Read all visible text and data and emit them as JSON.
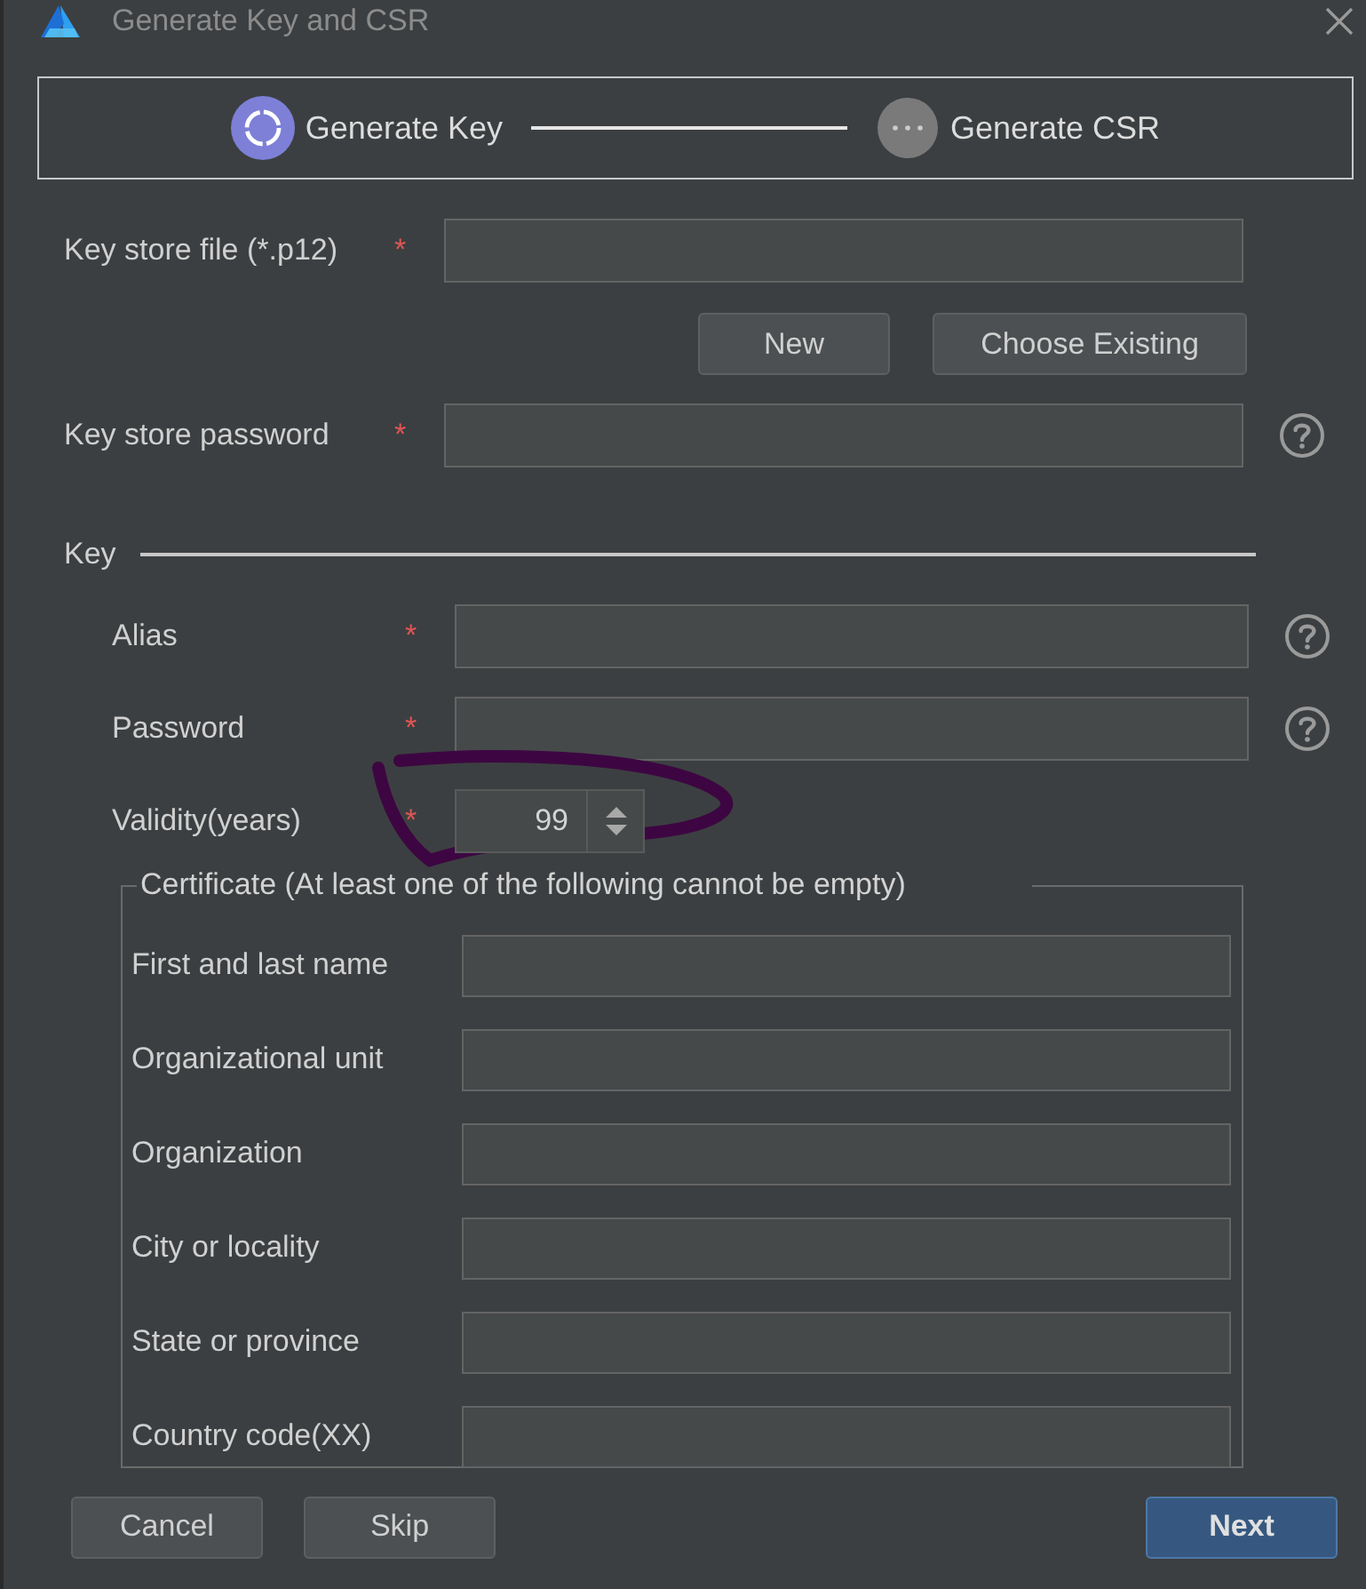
{
  "window": {
    "title": "Generate Key and CSR"
  },
  "steps": [
    {
      "label": "Generate Key",
      "selected": true
    },
    {
      "label": "Generate CSR",
      "selected": false
    }
  ],
  "store_rows": [
    {
      "kind": "field",
      "label": "Key store file (*.p12)",
      "required_mark": "*",
      "help": false
    },
    {
      "kind": "buttons",
      "buttons": [
        "New",
        "Choose Existing"
      ]
    },
    {
      "kind": "field",
      "label": "Key store password",
      "required_mark": "*",
      "help": true
    }
  ],
  "key_section": {
    "title": "Key",
    "rows": [
      {
        "kind": "field",
        "label": "Alias",
        "required_mark": "*",
        "help": true
      },
      {
        "kind": "field",
        "label": "Password",
        "required_mark": "*",
        "help": true
      },
      {
        "kind": "spinner",
        "label": "Validity(years)",
        "value": "99",
        "required_mark": "*",
        "help": false
      }
    ]
  },
  "certificate": {
    "legend": "Certificate (At least one of the following cannot be empty)",
    "fields": [
      "First and last name",
      "Organizational unit",
      "Organization",
      "City or locality",
      "State or province",
      "Country code(XX)"
    ]
  },
  "footer": {
    "buttons": [
      {
        "label": "Cancel",
        "primary": false
      },
      {
        "label": "Skip",
        "primary": false
      },
      {
        "label": "Next",
        "primary": true
      }
    ]
  }
}
